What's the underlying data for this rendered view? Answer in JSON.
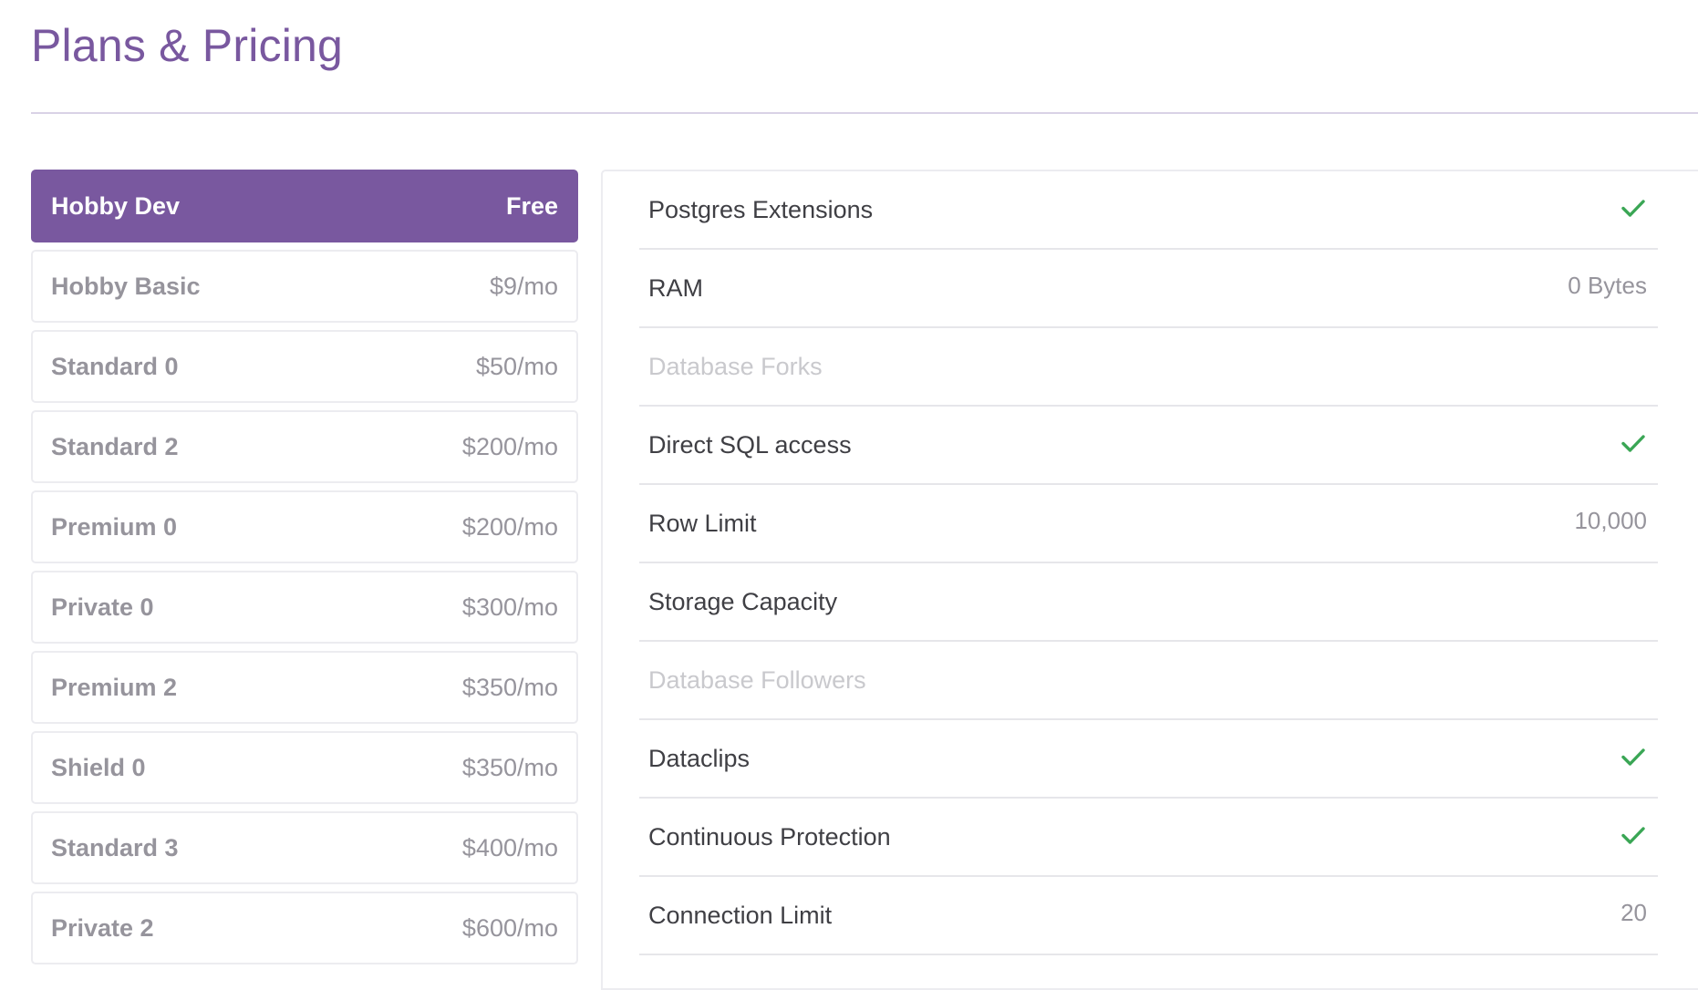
{
  "page": {
    "title": "Plans & Pricing"
  },
  "colors": {
    "accent": "#79589f",
    "check": "#3aa655",
    "muted_text": "#96949c",
    "disabled_text": "#c9c9cd",
    "border": "#ececf0"
  },
  "plans": [
    {
      "name": "Hobby Dev",
      "price": "Free",
      "selected": true
    },
    {
      "name": "Hobby Basic",
      "price": "$9/mo",
      "selected": false
    },
    {
      "name": "Standard 0",
      "price": "$50/mo",
      "selected": false
    },
    {
      "name": "Standard 2",
      "price": "$200/mo",
      "selected": false
    },
    {
      "name": "Premium 0",
      "price": "$200/mo",
      "selected": false
    },
    {
      "name": "Private 0",
      "price": "$300/mo",
      "selected": false
    },
    {
      "name": "Premium 2",
      "price": "$350/mo",
      "selected": false
    },
    {
      "name": "Shield 0",
      "price": "$350/mo",
      "selected": false
    },
    {
      "name": "Standard 3",
      "price": "$400/mo",
      "selected": false
    },
    {
      "name": "Private 2",
      "price": "$600/mo",
      "selected": false
    }
  ],
  "features": [
    {
      "label": "Postgres Extensions",
      "value": "",
      "check": true,
      "enabled": true,
      "icon": "check-icon"
    },
    {
      "label": "RAM",
      "value": "0 Bytes",
      "check": false,
      "enabled": true
    },
    {
      "label": "Database Forks",
      "value": "",
      "check": false,
      "enabled": false
    },
    {
      "label": "Direct SQL access",
      "value": "",
      "check": true,
      "enabled": true,
      "icon": "check-icon"
    },
    {
      "label": "Row Limit",
      "value": "10,000",
      "check": false,
      "enabled": true
    },
    {
      "label": "Storage Capacity",
      "value": "",
      "check": false,
      "enabled": true
    },
    {
      "label": "Database Followers",
      "value": "",
      "check": false,
      "enabled": false
    },
    {
      "label": "Dataclips",
      "value": "",
      "check": true,
      "enabled": true,
      "icon": "check-icon"
    },
    {
      "label": "Continuous Protection",
      "value": "",
      "check": true,
      "enabled": true,
      "icon": "check-icon"
    },
    {
      "label": "Connection Limit",
      "value": "20",
      "check": false,
      "enabled": true
    }
  ]
}
